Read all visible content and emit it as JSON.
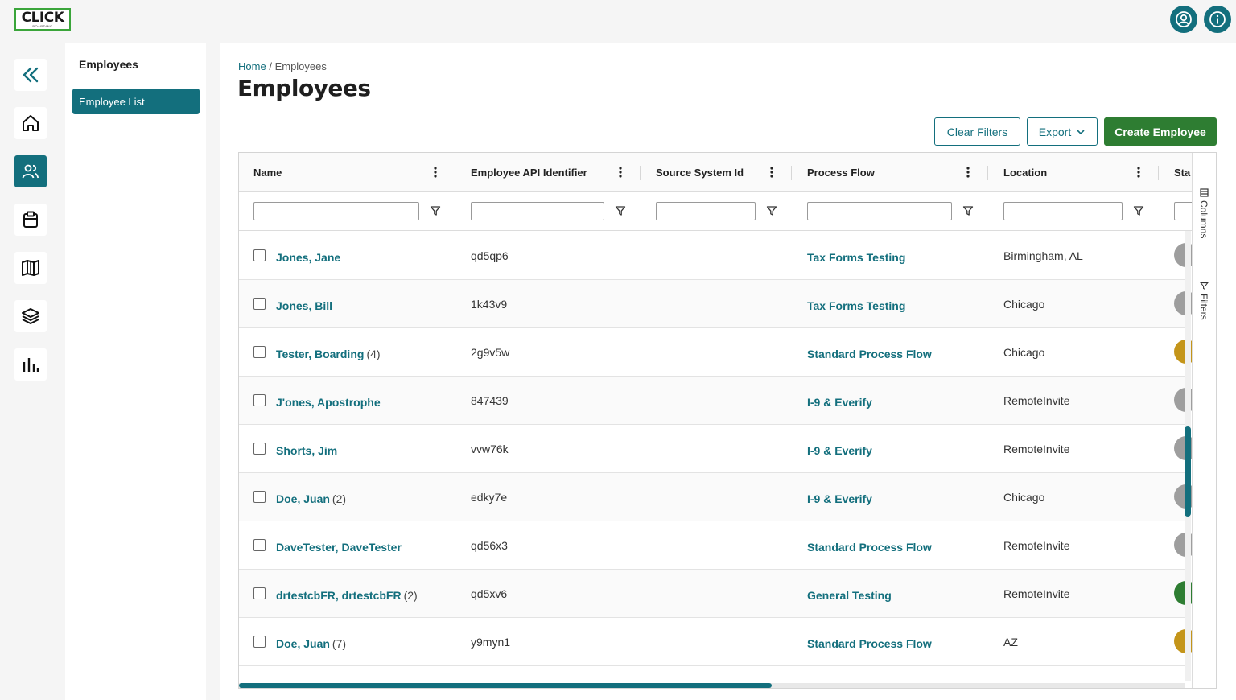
{
  "app": {
    "logo_text": "CLICK",
    "logo_subtext": "BOARDING"
  },
  "topbar": {
    "icons": [
      "user-icon",
      "info-icon"
    ]
  },
  "rail": {
    "items": [
      {
        "icon": "collapse-icon",
        "active": false
      },
      {
        "icon": "home-icon",
        "active": false
      },
      {
        "icon": "users-icon",
        "active": true
      },
      {
        "icon": "clipboard-icon",
        "active": false
      },
      {
        "icon": "map-icon",
        "active": false
      },
      {
        "icon": "layers-icon",
        "active": false
      },
      {
        "icon": "bar-chart-icon",
        "active": false
      }
    ]
  },
  "subnav": {
    "title": "Employees",
    "items": [
      {
        "label": "Employee List",
        "active": true
      }
    ]
  },
  "breadcrumb": {
    "home": "Home",
    "sep": "/",
    "current": "Employees"
  },
  "page": {
    "title": "Employees"
  },
  "actions": {
    "clear_filters": "Clear Filters",
    "export": "Export",
    "create_employee": "Create Employee"
  },
  "grid": {
    "columns": [
      "Name",
      "Employee API Identifier",
      "Source System Id",
      "Process Flow",
      "Location",
      "Sta"
    ],
    "side_tabs": [
      "Columns",
      "Filters"
    ],
    "rows": [
      {
        "name": "Jones, Jane",
        "count": "",
        "api": "qd5qp6",
        "flow": "Tax Forms Testing",
        "location": "Birmingham, AL",
        "status_color": "#9e9e9e"
      },
      {
        "name": "Jones, Bill",
        "count": "",
        "api": "1k43v9",
        "flow": "Tax Forms Testing",
        "location": "Chicago",
        "status_color": "#9e9e9e"
      },
      {
        "name": "Tester, Boarding",
        "count": "(4)",
        "api": "2g9v5w",
        "flow": "Standard Process Flow",
        "location": "Chicago",
        "status_color": "#c4951a"
      },
      {
        "name": "J'ones, Apostrophe",
        "count": "",
        "api": "847439",
        "flow": "I-9 & Everify",
        "location": "RemoteInvite",
        "status_color": "#9e9e9e"
      },
      {
        "name": "Shorts, Jim",
        "count": "",
        "api": "vvw76k",
        "flow": "I-9 & Everify",
        "location": "RemoteInvite",
        "status_color": "#9e9e9e"
      },
      {
        "name": "Doe, Juan",
        "count": "(2)",
        "api": "edky7e",
        "flow": "I-9 & Everify",
        "location": "Chicago",
        "status_color": "#9e9e9e"
      },
      {
        "name": "DaveTester, DaveTester",
        "count": "",
        "api": "qd56x3",
        "flow": "Standard Process Flow",
        "location": "RemoteInvite",
        "status_color": "#9e9e9e"
      },
      {
        "name": "drtestcbFR, drtestcbFR",
        "count": "(2)",
        "api": "qd5xv6",
        "flow": "General Testing",
        "location": "RemoteInvite",
        "status_color": "#2e7d32"
      },
      {
        "name": "Doe, Juan",
        "count": "(7)",
        "api": "y9myn1",
        "flow": "Standard Process Flow",
        "location": "AZ",
        "status_color": "#c4951a"
      }
    ]
  },
  "colors": {
    "primary": "#136f7d",
    "success": "#2e7d32"
  }
}
